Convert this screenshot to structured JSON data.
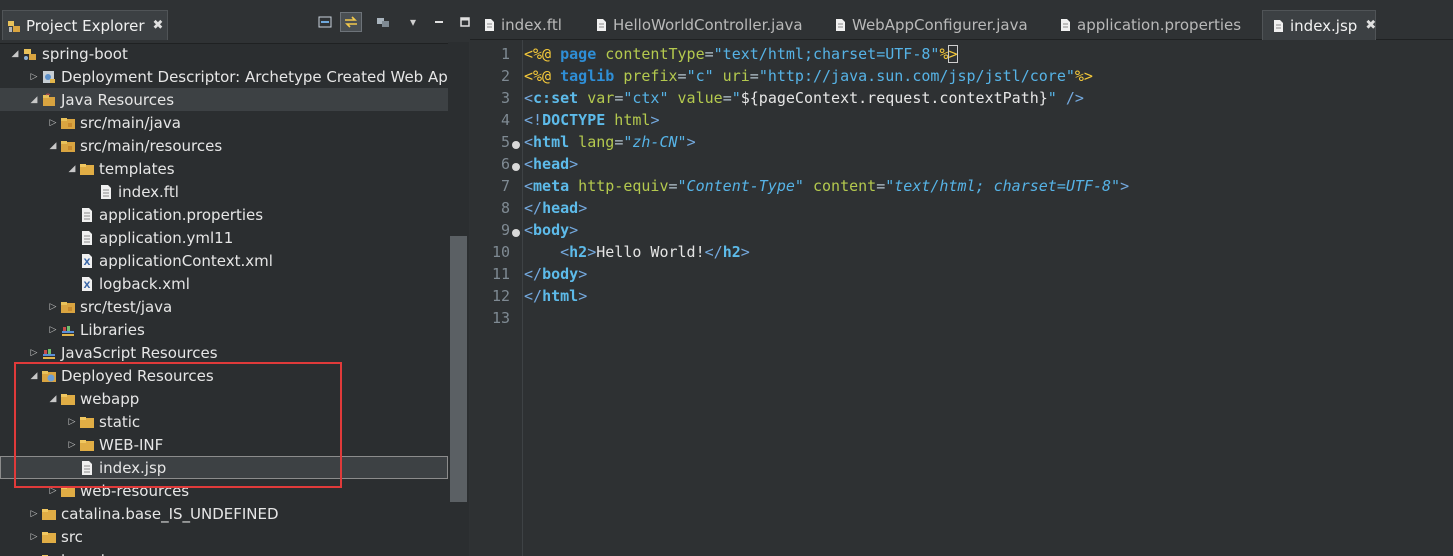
{
  "explorer": {
    "title": "Project Explorer",
    "close": "✖",
    "toolbar": [
      "collapse-all",
      "link-with-editor",
      "filter",
      "view-menu",
      "minimize",
      "maximize"
    ],
    "rows": [
      {
        "indent": 0,
        "twisty": "◢",
        "icon": "project-icon",
        "label": "spring-boot"
      },
      {
        "indent": 1,
        "twisty": "▷",
        "icon": "deployment-descriptor-icon",
        "label": "Deployment Descriptor: Archetype Created Web App"
      },
      {
        "indent": 1,
        "twisty": "◢",
        "icon": "java-resources-icon",
        "label": "Java Resources",
        "selected": true
      },
      {
        "indent": 2,
        "twisty": "▷",
        "icon": "package-folder-icon",
        "label": "src/main/java"
      },
      {
        "indent": 2,
        "twisty": "◢",
        "icon": "package-folder-icon",
        "label": "src/main/resources"
      },
      {
        "indent": 3,
        "twisty": "◢",
        "icon": "folder-icon",
        "label": "templates"
      },
      {
        "indent": 4,
        "twisty": "",
        "icon": "file-icon",
        "label": "index.ftl"
      },
      {
        "indent": 3,
        "twisty": "",
        "icon": "file-icon",
        "label": "application.properties"
      },
      {
        "indent": 3,
        "twisty": "",
        "icon": "file-icon",
        "label": "application.yml11"
      },
      {
        "indent": 3,
        "twisty": "",
        "icon": "xml-file-icon",
        "label": "applicationContext.xml"
      },
      {
        "indent": 3,
        "twisty": "",
        "icon": "xml-file-icon",
        "label": "logback.xml"
      },
      {
        "indent": 2,
        "twisty": "▷",
        "icon": "package-folder-icon",
        "label": "src/test/java"
      },
      {
        "indent": 2,
        "twisty": "▷",
        "icon": "libraries-icon",
        "label": "Libraries"
      },
      {
        "indent": 1,
        "twisty": "▷",
        "icon": "libraries-icon",
        "label": "JavaScript Resources"
      },
      {
        "indent": 1,
        "twisty": "◢",
        "icon": "deployed-resources-icon",
        "label": "Deployed Resources"
      },
      {
        "indent": 2,
        "twisty": "◢",
        "icon": "folder-icon",
        "label": "webapp"
      },
      {
        "indent": 3,
        "twisty": "▷",
        "icon": "folder-icon",
        "label": "static"
      },
      {
        "indent": 3,
        "twisty": "▷",
        "icon": "folder-icon",
        "label": "WEB-INF"
      },
      {
        "indent": 3,
        "twisty": "",
        "icon": "file-icon",
        "label": "index.jsp",
        "current": true
      },
      {
        "indent": 2,
        "twisty": "▷",
        "icon": "folder-icon",
        "label": "web-resources"
      },
      {
        "indent": 1,
        "twisty": "▷",
        "icon": "folder-icon",
        "label": "catalina.base_IS_UNDEFINED"
      },
      {
        "indent": 1,
        "twisty": "▷",
        "icon": "folder-icon",
        "label": "src"
      },
      {
        "indent": 1,
        "twisty": "▷",
        "icon": "folder-icon",
        "label": "target"
      }
    ]
  },
  "editor": {
    "tabs": [
      {
        "label": "index.ftl",
        "active": false
      },
      {
        "label": "HelloWorldController.java",
        "active": false
      },
      {
        "label": "WebAppConfigurer.java",
        "active": false
      },
      {
        "label": "application.properties",
        "active": false
      },
      {
        "label": "index.jsp",
        "active": true,
        "close": "✖"
      }
    ],
    "line_numbers": [
      "1",
      "2",
      "3",
      "4",
      "5",
      "6",
      "7",
      "8",
      "9",
      "10",
      "11",
      "12",
      "13"
    ],
    "fold_lines": [
      5,
      6,
      9
    ],
    "code": {
      "l1": [
        "<%@ ",
        "page",
        " contentType",
        "=",
        "\"text/html;charset=UTF-8\"",
        "%",
        ">"
      ],
      "l2": [
        "<%@ ",
        "taglib",
        " prefix",
        "=",
        "\"c\"",
        " uri",
        "=",
        "\"http://java.sun.com/jsp/jstl/core\"",
        "%>"
      ],
      "l3": [
        "<",
        "c:set",
        " var",
        "=",
        "\"ctx\"",
        " value",
        "=",
        "\"",
        "${pageContext.request.contextPath}",
        "\"",
        " />"
      ],
      "l4": [
        "<!",
        "DOCTYPE",
        " html",
        ">"
      ],
      "l5": [
        "<",
        "html",
        " lang",
        "=",
        "\"zh-CN\"",
        ">"
      ],
      "l6": [
        "<",
        "head",
        ">"
      ],
      "l7": [
        "<",
        "meta",
        " http-equiv",
        "=",
        "\"Content-Type\"",
        " content",
        "=",
        "\"text/html; charset=UTF-8\"",
        ">"
      ],
      "l8": [
        "</",
        "head",
        ">"
      ],
      "l9": [
        "<",
        "body",
        ">"
      ],
      "l10": [
        "    ",
        "<",
        "h2",
        ">",
        "Hello World!",
        "</",
        "h2",
        ">"
      ],
      "l11": [
        "</",
        "body",
        ">"
      ],
      "l12": [
        "</",
        "html",
        ">"
      ]
    }
  },
  "colors": {
    "highlight_box": "#e03a3a",
    "directive": "#f5c93a",
    "keyword": "#2e8ed6",
    "attribute": "#b4c94e",
    "string": "#56b3e6"
  }
}
